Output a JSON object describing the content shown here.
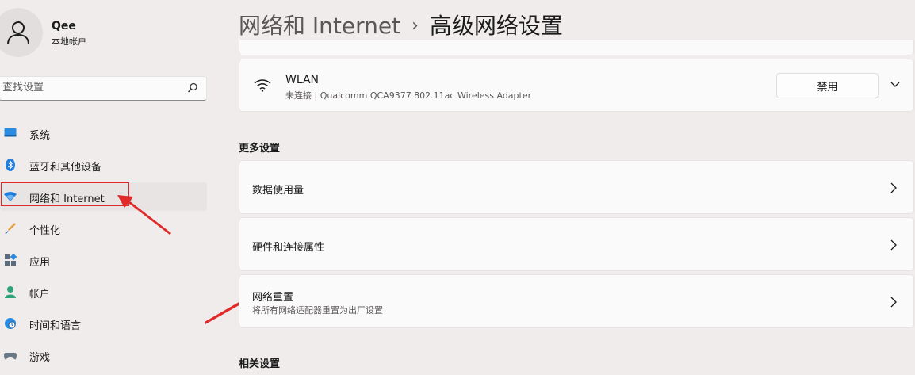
{
  "user": {
    "name": "Qee",
    "account_type": "本地帐户"
  },
  "search": {
    "placeholder": "查找设置"
  },
  "sidebar": {
    "items": [
      {
        "label": "系统",
        "icon": "system-icon"
      },
      {
        "label": "蓝牙和其他设备",
        "icon": "bluetooth-icon"
      },
      {
        "label": "网络和 Internet",
        "icon": "network-icon",
        "selected": true
      },
      {
        "label": "个性化",
        "icon": "brush-icon"
      },
      {
        "label": "应用",
        "icon": "apps-icon"
      },
      {
        "label": "帐户",
        "icon": "account-icon"
      },
      {
        "label": "时间和语言",
        "icon": "globe-clock-icon"
      },
      {
        "label": "游戏",
        "icon": "gamepad-icon"
      }
    ]
  },
  "header": {
    "parent": "网络和 Internet",
    "separator": "›",
    "current": "高级网络设置"
  },
  "wlan": {
    "title": "WLAN",
    "subtitle": "未连接 | Qualcomm QCA9377 802.11ac Wireless Adapter",
    "disable_label": "禁用"
  },
  "more_settings": {
    "title": "更多设置",
    "items": [
      {
        "title": "数据使用量"
      },
      {
        "title": "硬件和连接属性"
      },
      {
        "title": "网络重置",
        "subtitle": "将所有网络适配器重置为出厂设置"
      }
    ]
  },
  "related_settings": {
    "title": "相关设置"
  },
  "colors": {
    "accent": "#0067c0",
    "annotation_red": "#e02a2a",
    "background": "#f1ecec",
    "card": "#fbfafa"
  }
}
